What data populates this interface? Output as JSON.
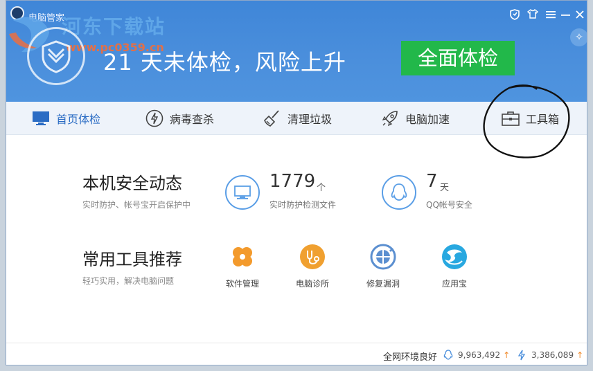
{
  "titlebar": {
    "app_title": "电脑管家"
  },
  "watermark": {
    "site_name": "河东下载站",
    "site_url": "www.pc0359.cn"
  },
  "header": {
    "status_text": "21 天未体检，风险上升",
    "scan_button": "全面体检"
  },
  "nav": {
    "items": [
      {
        "label": "首页体检",
        "icon": "monitor-icon"
      },
      {
        "label": "病毒查杀",
        "icon": "lightning-icon"
      },
      {
        "label": "清理垃圾",
        "icon": "broom-icon"
      },
      {
        "label": "电脑加速",
        "icon": "rocket-icon"
      },
      {
        "label": "工具箱",
        "icon": "toolbox-icon"
      }
    ]
  },
  "security": {
    "title": "本机安全动态",
    "subtitle": "实时防护、帐号宝开启保护中",
    "files_count": "1779",
    "files_unit": "个",
    "files_label": "实时防护检测文件",
    "qq_days": "7",
    "qq_unit": "天",
    "qq_label": "QQ帐号安全"
  },
  "tools": {
    "title": "常用工具推荐",
    "subtitle": "轻巧实用，解决电脑问题",
    "items": [
      {
        "label": "软件管理",
        "color": "#f39a2c"
      },
      {
        "label": "电脑诊所",
        "color": "#f0a030"
      },
      {
        "label": "修复漏洞",
        "color": "#5b8fd0"
      },
      {
        "label": "应用宝",
        "color": "#28a8e0"
      }
    ]
  },
  "footer": {
    "status": "全网环境良好",
    "stat1": "9,963,492",
    "stat2": "3,386,089"
  }
}
